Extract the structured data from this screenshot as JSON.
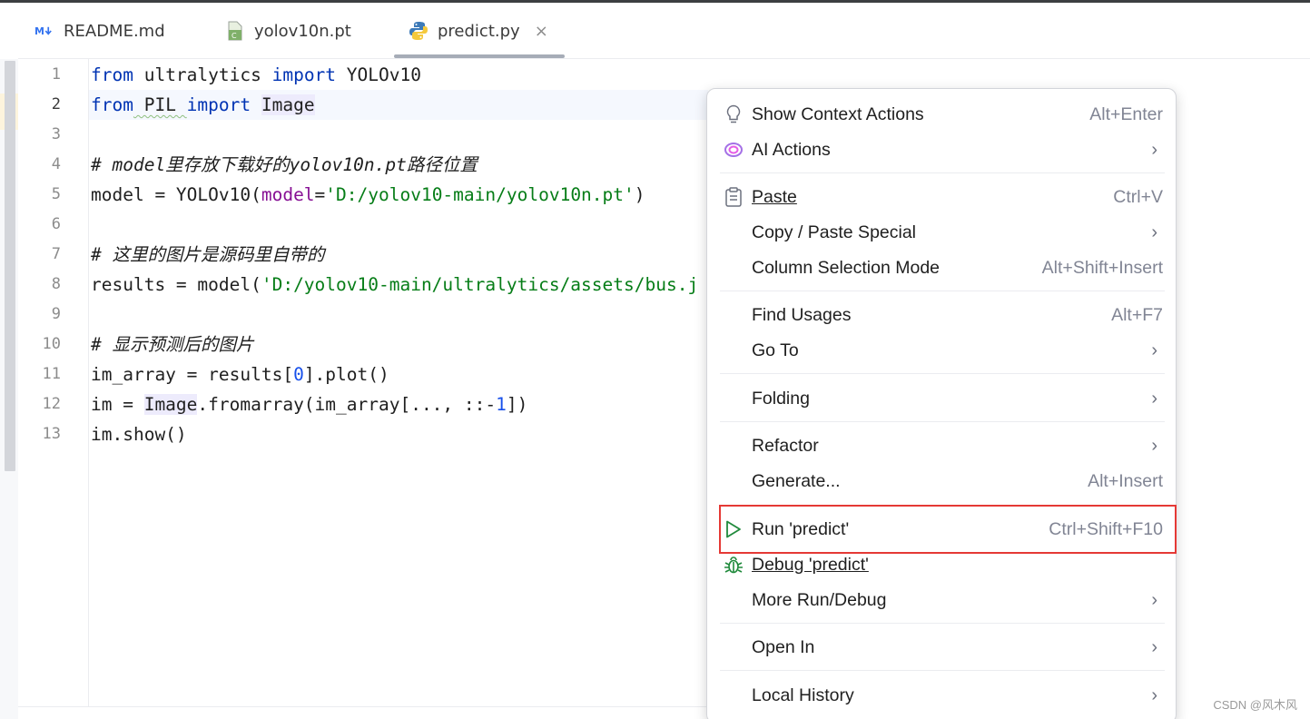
{
  "tabs": [
    {
      "icon": "markdown-icon",
      "label": "README.md"
    },
    {
      "icon": "pt-file-icon",
      "label": "yolov10n.pt"
    },
    {
      "icon": "python-icon",
      "label": "predict.py",
      "active": true
    }
  ],
  "tab_close": "×",
  "editor": {
    "line_numbers": [
      "1",
      "2",
      "3",
      "4",
      "5",
      "6",
      "7",
      "8",
      "9",
      "10",
      "11",
      "12",
      "13"
    ],
    "current_line": 2,
    "code": {
      "l1": {
        "kw1": "from",
        "mod": " ultralytics ",
        "kw2": "import",
        "name": " YOLOv10"
      },
      "l2": {
        "kw1": "from",
        "mod": " PIL ",
        "kw2": "import",
        "name": "Image"
      },
      "l4": "# model里存放下载好的yolov10n.pt路径位置",
      "l5": {
        "a": "model = YOLOv10(",
        "p": "model",
        "eq": "=",
        "s": "'D:/yolov10-main/yolov10n.pt'",
        "e": ")"
      },
      "l7": "# 这里的图片是源码里自带的",
      "l8": {
        "a": "results = model(",
        "s": "'D:/yolov10-main/ultralytics/assets/bus.j"
      },
      "l10": "# 显示预测后的图片",
      "l11": {
        "a": "im_array = results[",
        "n": "0",
        "e": "].plot()"
      },
      "l12": {
        "a": "im = ",
        "cls": "Image",
        "b": ".fromarray(im_array[..., ::-",
        "n": "1",
        "e": "])"
      },
      "l13": "im.show()"
    }
  },
  "context_menu": {
    "items": [
      {
        "label": "Show Context Actions",
        "shortcut": "Alt+Enter",
        "icon": "lightbulb-icon"
      },
      {
        "label": "AI Actions",
        "submenu": true,
        "icon": "ai-spiral-icon"
      },
      {
        "label": "Paste",
        "shortcut": "Ctrl+V",
        "icon": "clipboard-icon"
      },
      {
        "label": "Copy / Paste Special",
        "submenu": true
      },
      {
        "label": "Column Selection Mode",
        "shortcut": "Alt+Shift+Insert"
      },
      {
        "label": "Find Usages",
        "shortcut": "Alt+F7"
      },
      {
        "label": "Go To",
        "submenu": true
      },
      {
        "label": "Folding",
        "submenu": true
      },
      {
        "label": "Refactor",
        "submenu": true
      },
      {
        "label": "Generate...",
        "shortcut": "Alt+Insert"
      },
      {
        "label": "Run 'predict'",
        "shortcut": "Ctrl+Shift+F10",
        "icon": "run-icon"
      },
      {
        "label": "Debug 'predict'",
        "icon": "debug-icon"
      },
      {
        "label": "More Run/Debug",
        "submenu": true
      },
      {
        "label": "Open In",
        "submenu": true
      },
      {
        "label": "Local History",
        "submenu": true
      }
    ],
    "chevron": "›"
  },
  "watermark": "CSDN @风木风",
  "colors": {
    "highlight_border": "#e53935",
    "keyword": "#0033b3",
    "string": "#067d17",
    "comment": "#8c8c8c"
  }
}
